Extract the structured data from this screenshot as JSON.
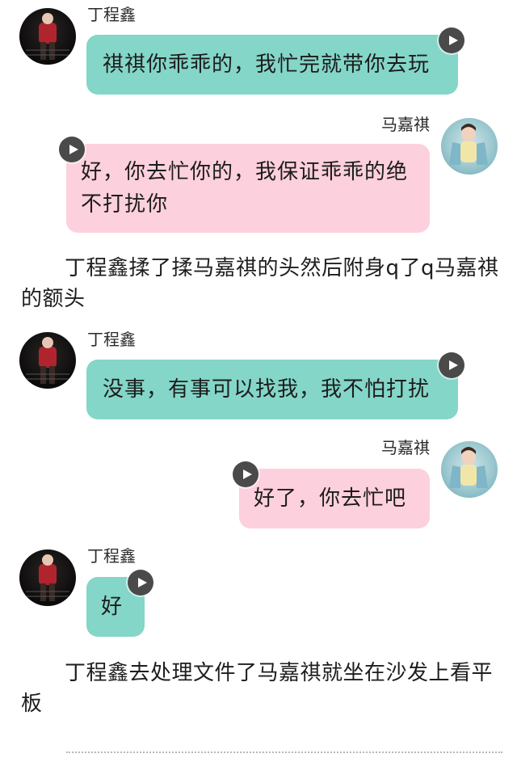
{
  "messages": [
    {
      "sender": "丁程鑫",
      "text": "祺祺你乖乖的，我忙完就带你去玩"
    },
    {
      "sender": "马嘉祺",
      "text": "好，你去忙你的，我保证乖乖的绝不打扰你"
    },
    {
      "sender": "丁程鑫",
      "text": "没事，有事可以找我，我不怕打扰"
    },
    {
      "sender": "马嘉祺",
      "text": "好了，你去忙吧"
    },
    {
      "sender": "丁程鑫",
      "text": "好"
    }
  ],
  "narration": [
    "丁程鑫揉了揉马嘉祺的头然后附身q了q马嘉祺的额头",
    "丁程鑫去处理文件了马嘉祺就坐在沙发上看平板"
  ],
  "colors": {
    "left_bubble": "#84d6c8",
    "right_bubble": "#fdd0dd",
    "play_button": "#4a4a4a"
  },
  "icons": {
    "voice_play": "play-icon",
    "avatar_left": "avatar-ding",
    "avatar_right": "avatar-ma"
  }
}
